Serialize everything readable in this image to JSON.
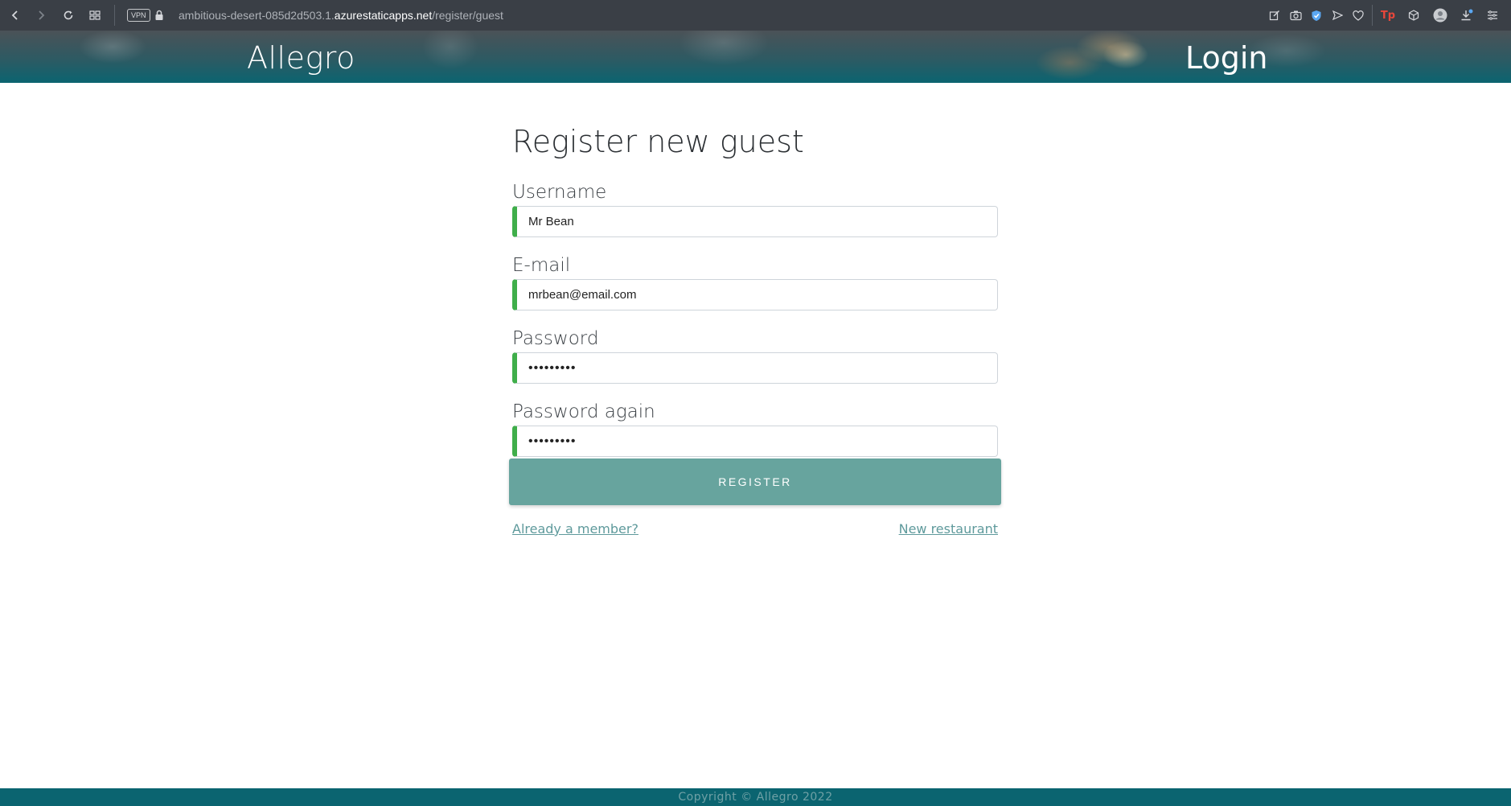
{
  "browser": {
    "vpn_label": "VPN",
    "url_prefix": "ambitious-desert-085d2d503.1.",
    "url_host": "azurestaticapps.net",
    "url_path": "/register/guest",
    "icons": [
      "back-icon",
      "forward-icon",
      "reload-icon",
      "tabs-grid-icon",
      "lock-icon",
      "edit-icon",
      "camera-icon",
      "shield-icon",
      "send-icon",
      "heart-icon",
      "extension-tp-icon",
      "cube-icon",
      "profile-icon",
      "download-icon",
      "menu-icon"
    ]
  },
  "header": {
    "brand": "Allegro",
    "login_label": "Login"
  },
  "form": {
    "title": "Register new guest",
    "username_label": "Username",
    "username_value": "Mr Bean",
    "email_label": "E-mail",
    "email_value": "mrbean@email.com",
    "password_label": "Password",
    "password_value": "•••••••••",
    "password_again_label": "Password again",
    "password_again_value": "•••••••••",
    "submit_label": "REGISTER",
    "member_link": "Already a member?",
    "restaurant_link": "New restaurant"
  },
  "colors": {
    "accent": "#67a49e",
    "valid_border": "#3fae4a",
    "footer_bg": "#0b6470"
  },
  "footer": {
    "copyright": "Copyright © Allegro 2022"
  }
}
